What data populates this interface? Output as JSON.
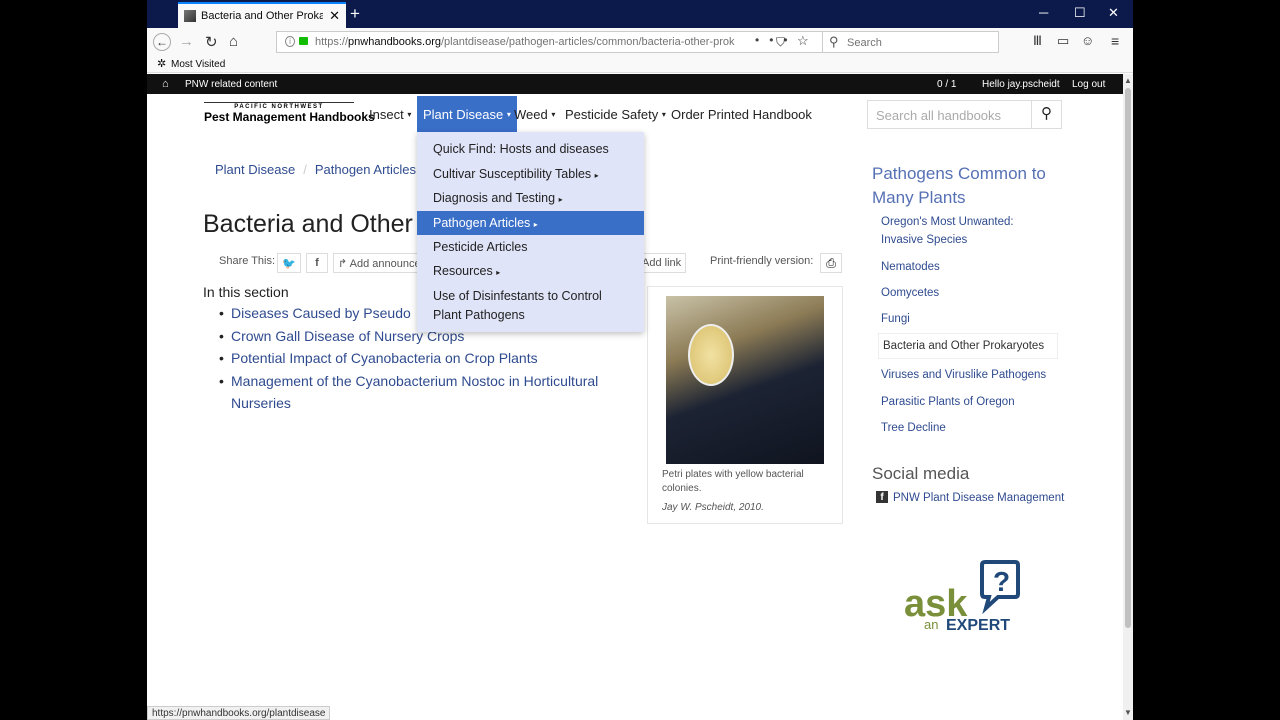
{
  "browser": {
    "tab_title": "Bacteria and Other Prokaryote",
    "url_prefix": "https://",
    "url_domain": "pnwhandbooks.org",
    "url_path": "/plantdisease/pathogen-articles/common/bacteria-other-prok",
    "search_placeholder": "Search",
    "bookmark": "Most Visited",
    "status_url": "https://pnwhandbooks.org/plantdisease"
  },
  "topstrip": {
    "related": "PNW related content",
    "count": "0 / 1",
    "hello": "Hello jay.pscheidt",
    "logout": "Log out"
  },
  "logo": {
    "small": "PACIFIC NORTHWEST",
    "big": "Pest Management Handbooks"
  },
  "nav": {
    "insect": "Insect",
    "plant_disease": "Plant Disease",
    "weed": "Weed",
    "pesticide_safety": "Pesticide Safety",
    "order": "Order Printed Handbook",
    "search_placeholder": "Search all handbooks"
  },
  "dropdown": [
    "Quick Find: Hosts and diseases",
    "Cultivar Susceptibility Tables",
    "Diagnosis and Testing",
    "Pathogen Articles",
    "Pesticide Articles",
    "Resources",
    "Use of Disinfestants to Control",
    "Plant Pathogens"
  ],
  "breadcrumb": [
    "Plant Disease",
    "Pathogen Articles"
  ],
  "page": {
    "title": "Bacteria and Other P",
    "share_label": "Share This:",
    "add_announce": "Add announce",
    "add_link": "Add link",
    "print_label": "Print-friendly version:",
    "in_section": "In this section",
    "section_items": [
      "Diseases Caused by Pseudo",
      "Crown Gall Disease of Nursery Crops",
      "Potential Impact of Cyanobacteria on Crop Plants",
      "Management of the Cyanobacterium Nostoc in Horticultural Nurseries"
    ]
  },
  "figure": {
    "caption": "Petri plates with yellow bacterial colonies.",
    "credit": "Jay W. Pscheidt, 2010."
  },
  "sidebar": {
    "title": "Pathogens Common to Many Plants",
    "items": [
      "Oregon's Most Unwanted: Invasive Species",
      "Nematodes",
      "Oomycetes",
      "Fungi",
      "Bacteria and Other Prokaryotes",
      "Viruses and Viruslike Pathogens",
      "Parasitic Plants of Oregon",
      "Tree Decline"
    ],
    "social_title": "Social media",
    "social_link": "PNW Plant Disease Management"
  },
  "ask": {
    "ask": "ask",
    "an": "an",
    "expert": "EXPERT"
  }
}
